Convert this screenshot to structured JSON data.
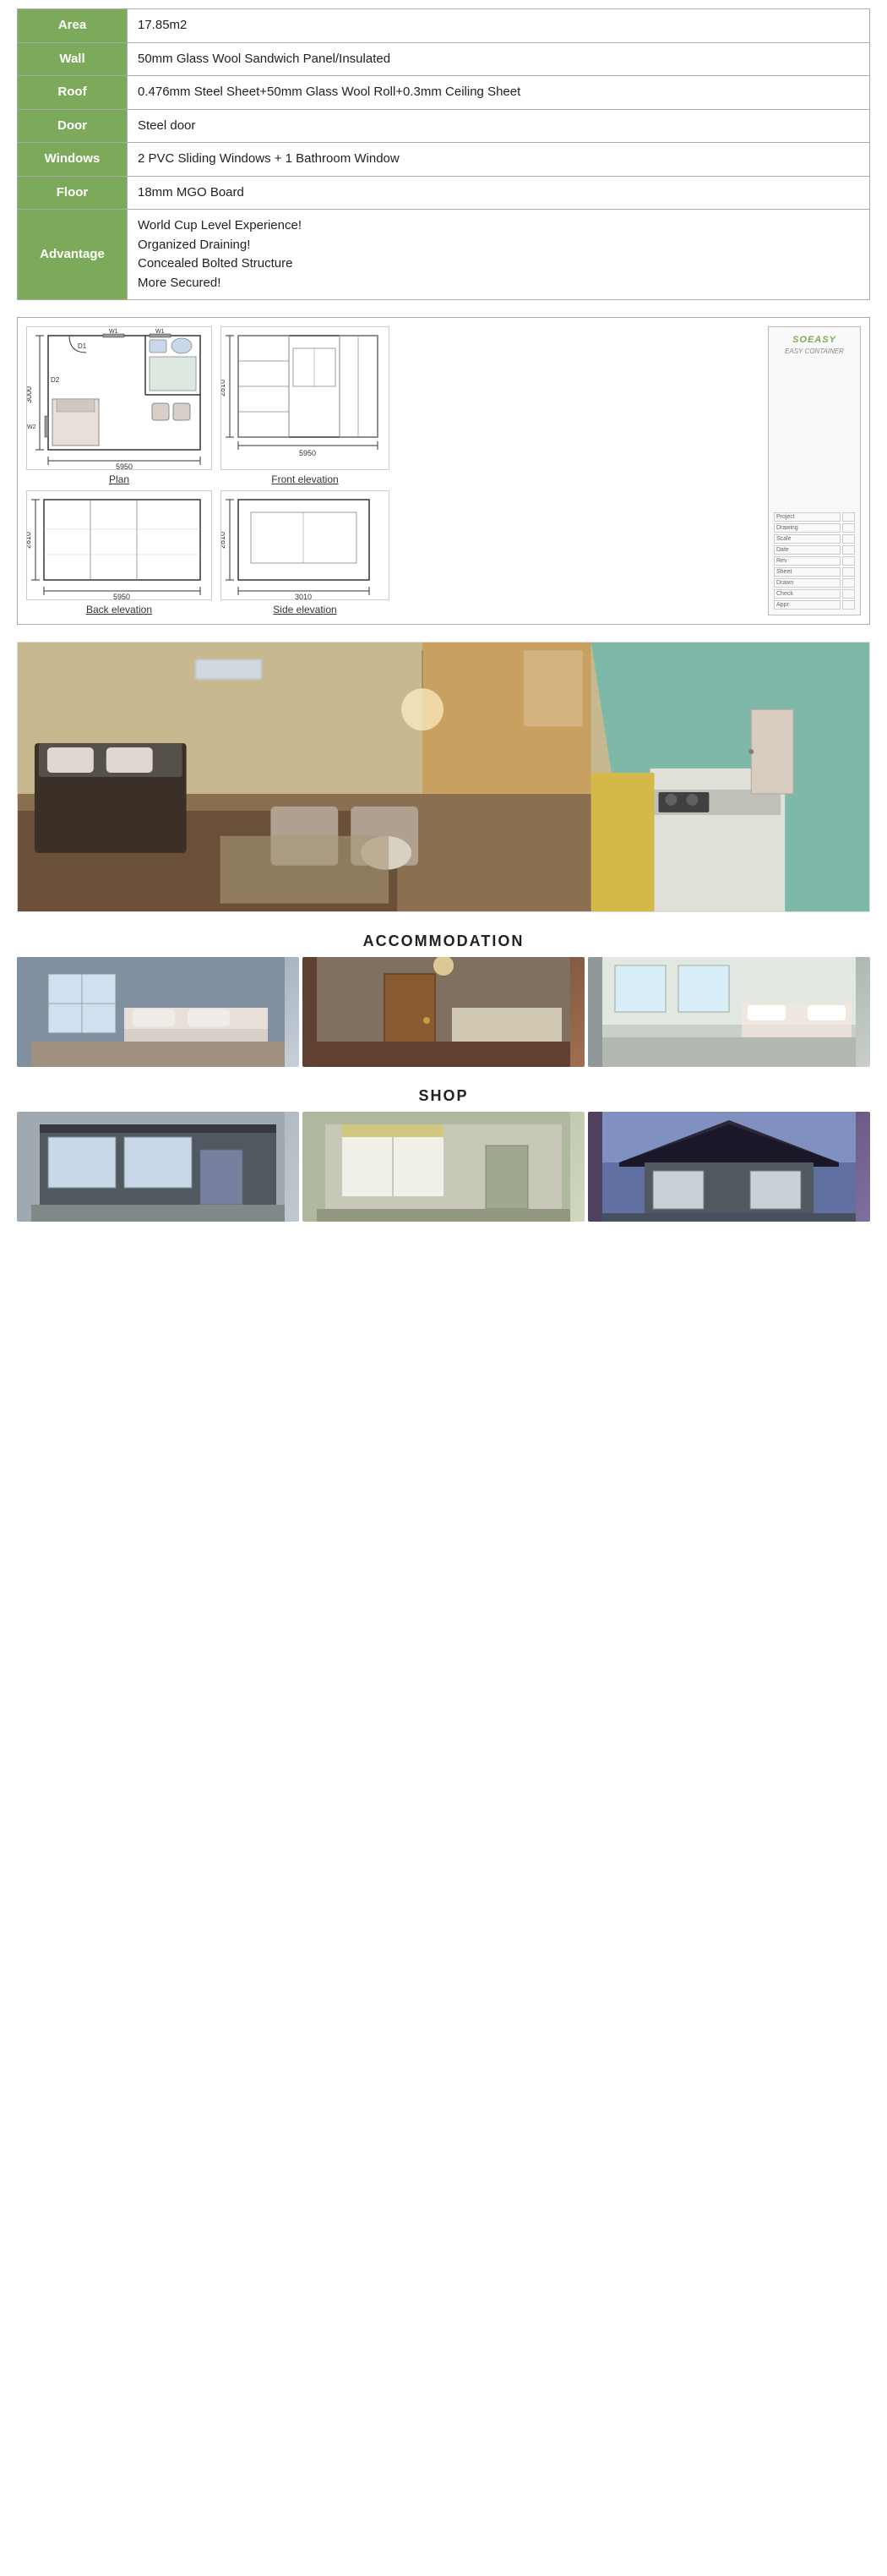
{
  "specs": {
    "rows": [
      {
        "label": "Area",
        "value": "17.85m2"
      },
      {
        "label": "Wall",
        "value": "50mm Glass Wool Sandwich Panel/Insulated"
      },
      {
        "label": "Roof",
        "value": "0.476mm Steel Sheet+50mm Glass Wool Roll+0.3mm Ceiling Sheet"
      },
      {
        "label": "Door",
        "value": "Steel door"
      },
      {
        "label": "Windows",
        "value": "2 PVC Sliding Windows + 1 Bathroom Window"
      },
      {
        "label": "Floor",
        "value": "18mm MGO Board"
      },
      {
        "label": "Advantage",
        "value": "World Cup Level Experience!\nOrganized Draining!\nConcealed Bolted Structure\nMore Secured!"
      }
    ]
  },
  "diagram": {
    "plan_label": "Plan",
    "front_elevation_label": "Front elevation",
    "back_elevation_label": "Back elevation",
    "side_elevation_label": "Side elevation",
    "dim_3000": "3000",
    "dim_5950_1": "5950",
    "dim_5950_2": "5950",
    "dim_5950_3": "5950",
    "dim_2810_1": "2810",
    "dim_2810_2": "2810",
    "dim_2810_3": "2810",
    "dim_3010": "3010",
    "label_D1": "D1",
    "label_D2": "D2",
    "label_W1_1": "W1",
    "label_W1_2": "W1",
    "label_W2": "W2",
    "soeasy_brand": "SOEASY",
    "soeasy_sub": "EASY CONTAINER"
  },
  "sections": {
    "accommodation_heading": "ACCOMMODATION",
    "shop_heading": "SHOP"
  },
  "accommodation_photos": [
    {
      "alt": "Bedroom with bed and window"
    },
    {
      "alt": "Interior with wooden door and kitchen counter"
    },
    {
      "alt": "Bright bedroom interior"
    }
  ],
  "shop_photos": [
    {
      "alt": "Container shop exterior view 1"
    },
    {
      "alt": "Container shop exterior view 2"
    },
    {
      "alt": "Container shop with canopy"
    }
  ]
}
